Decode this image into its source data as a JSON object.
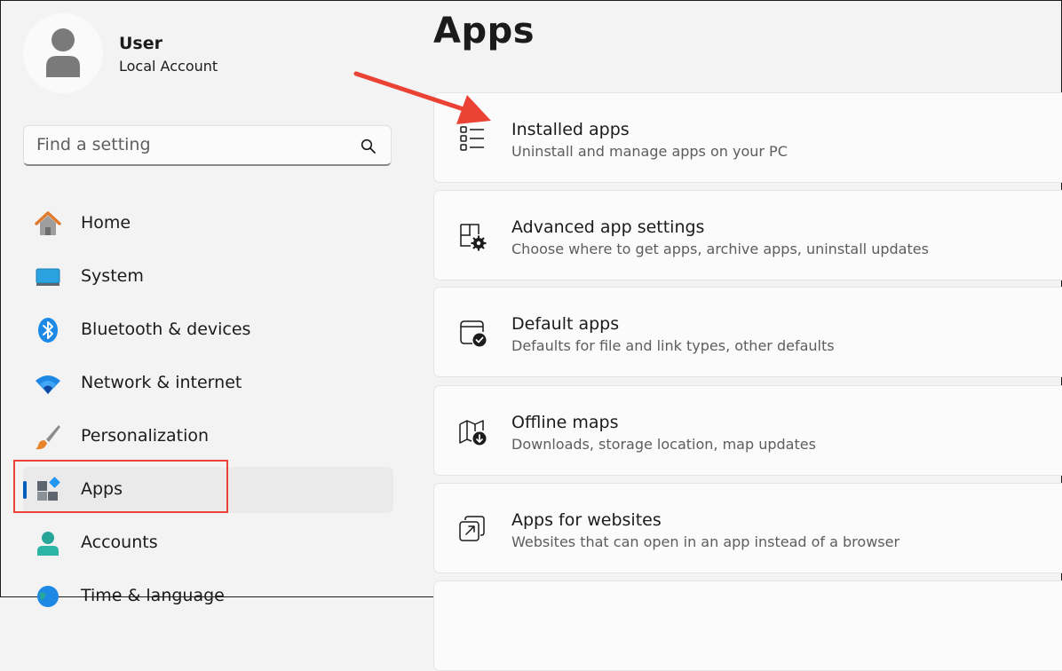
{
  "user": {
    "name": "User",
    "account_type": "Local Account"
  },
  "search": {
    "placeholder": "Find a setting"
  },
  "nav": {
    "items": [
      {
        "label": "Home",
        "icon": "home-icon"
      },
      {
        "label": "System",
        "icon": "system-icon"
      },
      {
        "label": "Bluetooth & devices",
        "icon": "bluetooth-icon"
      },
      {
        "label": "Network & internet",
        "icon": "wifi-icon"
      },
      {
        "label": "Personalization",
        "icon": "brush-icon"
      },
      {
        "label": "Apps",
        "icon": "apps-icon",
        "selected": true
      },
      {
        "label": "Accounts",
        "icon": "accounts-icon"
      },
      {
        "label": "Time & language",
        "icon": "globe-icon"
      }
    ]
  },
  "main": {
    "title": "Apps",
    "cards": [
      {
        "title": "Installed apps",
        "subtitle": "Uninstall and manage apps on your PC",
        "icon": "list-icon"
      },
      {
        "title": "Advanced app settings",
        "subtitle": "Choose where to get apps, archive apps, uninstall updates",
        "icon": "app-settings-icon"
      },
      {
        "title": "Default apps",
        "subtitle": "Defaults for file and link types, other defaults",
        "icon": "default-apps-icon"
      },
      {
        "title": "Offline maps",
        "subtitle": "Downloads, storage location, map updates",
        "icon": "map-icon"
      },
      {
        "title": "Apps for websites",
        "subtitle": "Websites that can open in an app instead of a browser",
        "icon": "open-in-app-icon"
      }
    ]
  },
  "colors": {
    "accent": "#005fb8",
    "annotation": "#ea4335"
  }
}
